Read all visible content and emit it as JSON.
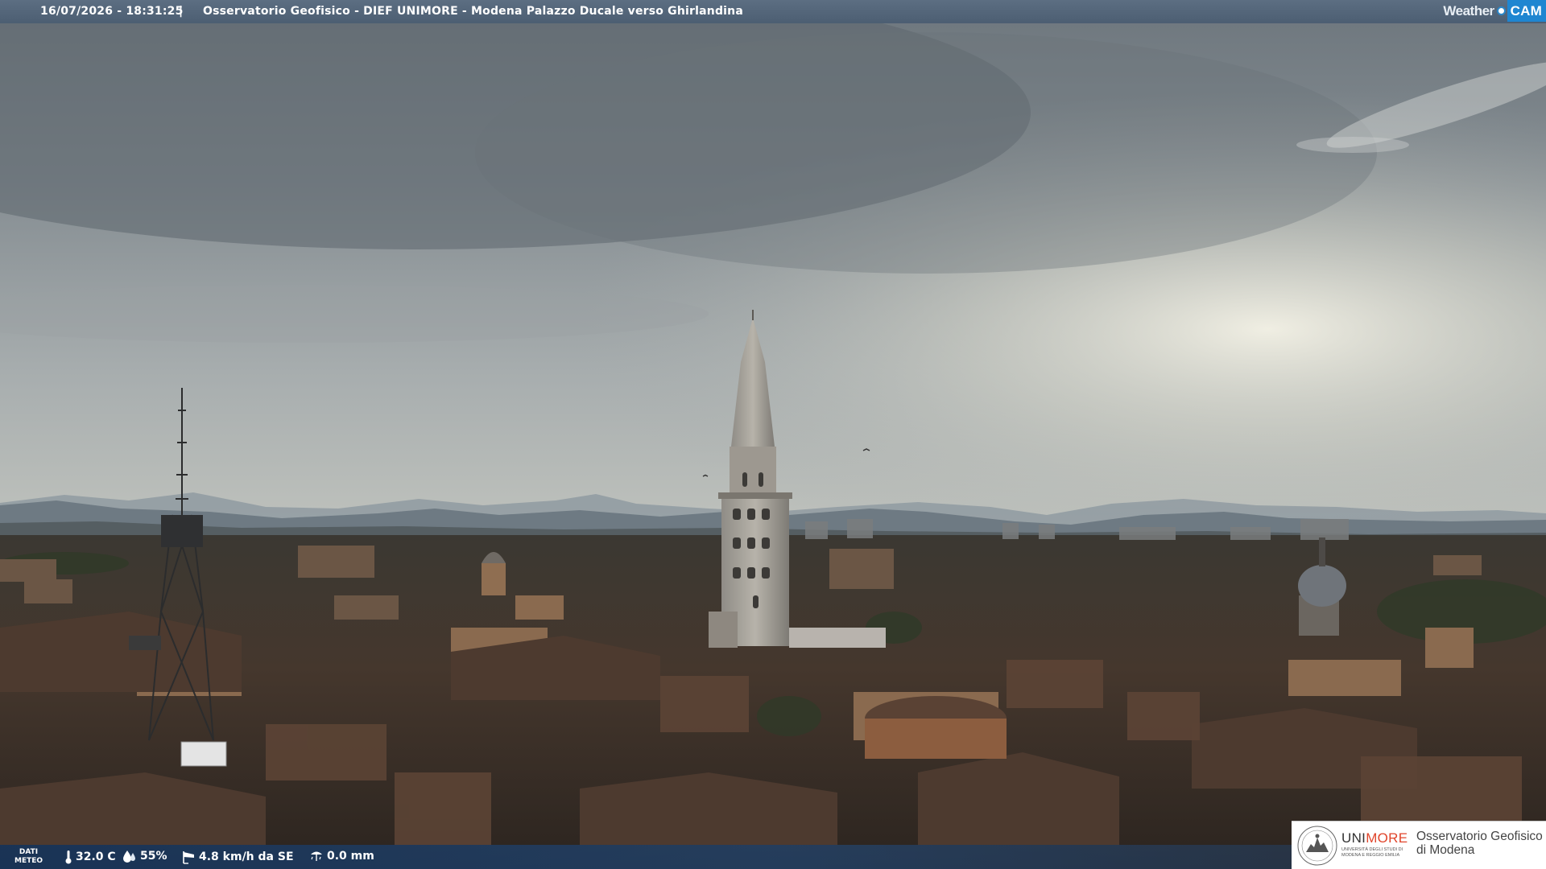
{
  "header": {
    "datetime": "16/07/2026 - 18:31:25",
    "separator": "|",
    "title": "Osservatorio Geofisico - DIEF UNIMORE - Modena Palazzo Ducale verso Ghirlandina",
    "brand_weather": "Weather",
    "brand_cam": "CAM"
  },
  "weather_data": {
    "label_line1": "DATI",
    "label_line2": "METEO",
    "temperature": "32.0 C",
    "humidity": "55%",
    "wind": "4.8 km/h da SE",
    "rain": "0.0 mm",
    "icons": {
      "temperature": "thermometer-icon",
      "humidity": "water-drop-icon",
      "wind": "windsock-icon",
      "rain": "rain-gauge-icon"
    }
  },
  "footer_logo": {
    "uni": "UNI",
    "more": "MORE",
    "subtitle": "UNIVERSITÀ DEGLI STUDI DI MODENA E REGGIO EMILIA",
    "osservatorio_line1": "Osservatorio Geofisico",
    "osservatorio_line2": "di Modena"
  },
  "colors": {
    "header_bar": "#54667a",
    "brand_cam": "#1f86d1",
    "unimore_accent": "#e0452b"
  }
}
